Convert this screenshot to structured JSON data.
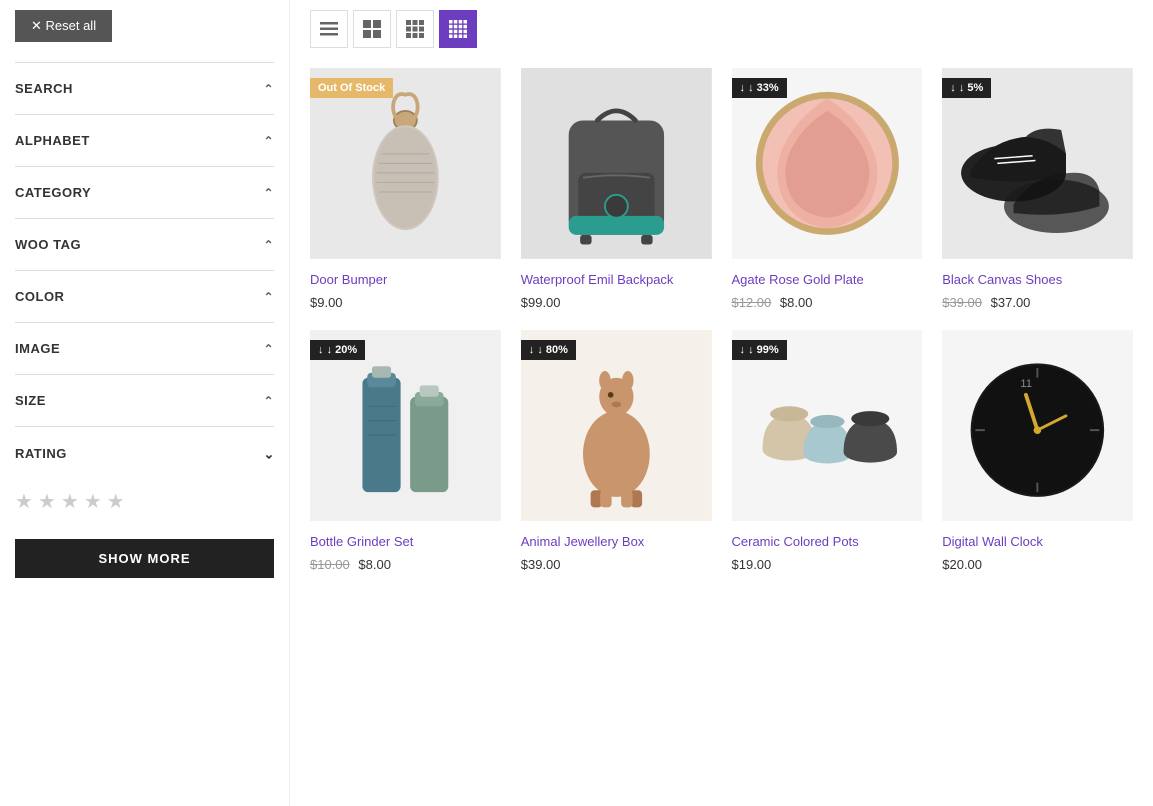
{
  "sidebar": {
    "reset_label": "✕ Reset all",
    "filters": [
      {
        "id": "search",
        "label": "SEARCH",
        "expanded": false
      },
      {
        "id": "alphabet",
        "label": "ALPHABET",
        "expanded": false
      },
      {
        "id": "category",
        "label": "CATEGORY",
        "expanded": false
      },
      {
        "id": "woo_tag",
        "label": "WOO TAG",
        "expanded": false
      },
      {
        "id": "color",
        "label": "COLOR",
        "expanded": false
      },
      {
        "id": "image",
        "label": "IMAGE",
        "expanded": false
      },
      {
        "id": "size",
        "label": "SIZE",
        "expanded": false
      },
      {
        "id": "rating",
        "label": "RATING",
        "expanded": true
      }
    ],
    "show_more_label": "SHOW MORE",
    "rating": {
      "stars": [
        "☆",
        "☆",
        "☆",
        "☆",
        "☆"
      ]
    }
  },
  "view_toggles": [
    {
      "id": "list",
      "icon": "≡",
      "active": false
    },
    {
      "id": "grid2",
      "icon": "⊞",
      "active": false
    },
    {
      "id": "grid3",
      "icon": "⊟",
      "active": false
    },
    {
      "id": "grid4",
      "icon": "⊠",
      "active": true
    }
  ],
  "products": [
    {
      "id": 1,
      "name": "Door Bumper",
      "price_regular": "$9.00",
      "price_sale": null,
      "price_original": null,
      "badge": "Out Of Stock",
      "badge_type": "out",
      "image_type": "door_bumper"
    },
    {
      "id": 2,
      "name": "Waterproof Emil Backpack",
      "price_regular": "$99.00",
      "price_sale": null,
      "price_original": null,
      "badge": null,
      "badge_type": null,
      "image_type": "backpack"
    },
    {
      "id": 3,
      "name": "Agate Rose Gold Plate",
      "price_regular": null,
      "price_sale": "$8.00",
      "price_original": "$12.00",
      "badge": "33%",
      "badge_type": "discount",
      "image_type": "plate"
    },
    {
      "id": 4,
      "name": "Black Canvas Shoes",
      "price_regular": null,
      "price_sale": "$37.00",
      "price_original": "$39.00",
      "badge": "5%",
      "badge_type": "discount",
      "image_type": "shoes"
    },
    {
      "id": 5,
      "name": "Bottle Grinder Set",
      "price_regular": null,
      "price_sale": "$8.00",
      "price_original": "$10.00",
      "badge": "20%",
      "badge_type": "discount",
      "image_type": "grinder"
    },
    {
      "id": 6,
      "name": "Animal Jewellery Box",
      "price_regular": "$39.00",
      "price_sale": null,
      "price_original": null,
      "badge": "80%",
      "badge_type": "discount",
      "image_type": "jewellery"
    },
    {
      "id": 7,
      "name": "Ceramic Colored Pots",
      "price_regular": "$19.00",
      "price_sale": null,
      "price_original": null,
      "badge": "99%",
      "badge_type": "discount",
      "image_type": "pots"
    },
    {
      "id": 8,
      "name": "Digital Wall Clock",
      "price_regular": "$20.00",
      "price_sale": null,
      "price_original": null,
      "badge": null,
      "badge_type": null,
      "image_type": "clock"
    }
  ],
  "colors": {
    "accent": "#6c3dbf",
    "badge_out": "#e6b86a",
    "badge_discount": "#222222"
  }
}
